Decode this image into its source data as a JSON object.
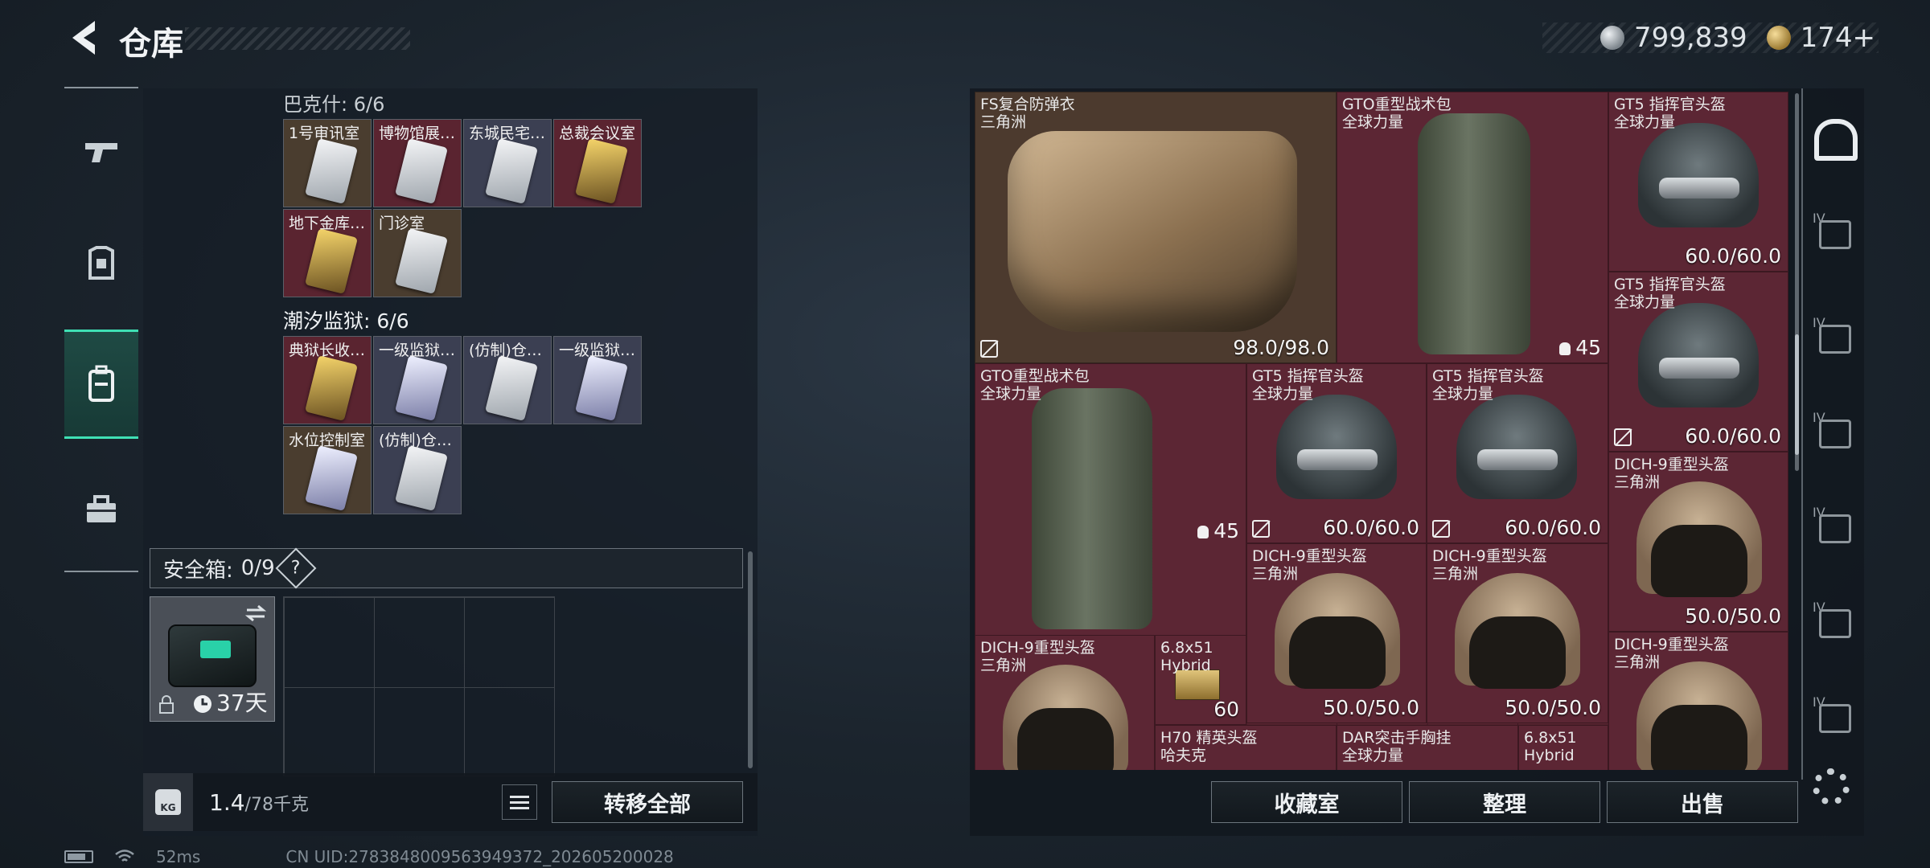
{
  "header": {
    "title": "仓库",
    "currency": [
      {
        "icon": "silver-coin-icon",
        "value": "799,839"
      },
      {
        "icon": "gold-coin-icon",
        "value": "174+"
      }
    ]
  },
  "left_nav": [
    {
      "icon": "weapon-icon"
    },
    {
      "icon": "armor-icon"
    },
    {
      "icon": "backpack-icon",
      "active": true
    },
    {
      "icon": "toolbox-icon"
    }
  ],
  "stash": {
    "group1": {
      "label": "巴克什: 6/6",
      "cards": [
        {
          "label": "1号审讯室",
          "bg": "brown",
          "key": "silver"
        },
        {
          "label": "博物馆展…",
          "bg": "red",
          "key": "silver"
        },
        {
          "label": "东城民宅…",
          "bg": "slate",
          "key": "silver"
        },
        {
          "label": "总裁会议室",
          "bg": "red",
          "key": "gold"
        },
        {
          "label": "地下金库…",
          "bg": "red",
          "key": "gold"
        },
        {
          "label": "门诊室",
          "bg": "brown",
          "key": "silver"
        }
      ]
    },
    "group2": {
      "label": "潮汐监狱: 6/6",
      "cards": [
        {
          "label": "典狱长收…",
          "bg": "red",
          "key": "gold"
        },
        {
          "label": "一级监狱…",
          "bg": "slate",
          "key": "blue"
        },
        {
          "label": "(仿制)仓…",
          "bg": "slate",
          "key": "silver"
        },
        {
          "label": "一级监狱…",
          "bg": "slate",
          "key": "blue"
        },
        {
          "label": "水位控制室",
          "bg": "brown",
          "key": "blue"
        },
        {
          "label": "(仿制)仓…",
          "bg": "slate",
          "key": "silver"
        }
      ]
    },
    "safe_box": {
      "label": "安全箱:",
      "count": "0/9",
      "help": "?"
    },
    "case_item": {
      "days": "37天",
      "swap_icon": "swap-icon",
      "lock_icon": "lock-icon",
      "clock_icon": "clock-icon"
    }
  },
  "weight": {
    "kg_label": "KG",
    "current": "1.4",
    "max": "/78千克"
  },
  "buttons": {
    "transfer_all": "转移全部",
    "collection": "收藏室",
    "organize": "整理",
    "sell": "出售"
  },
  "inventory": [
    {
      "name": "FS复合防弹衣",
      "sub": "三角洲",
      "dur": "98.0/98.0",
      "broken": true,
      "type": "vest",
      "bg": "brown"
    },
    {
      "name": "GTO重型战术包",
      "sub": "全球力量",
      "cap": "45",
      "type": "pack",
      "bg": "red"
    },
    {
      "name": "GT5 指挥官头盔",
      "sub": "全球力量",
      "dur": "60.0/60.0",
      "type": "gt5",
      "bg": "red"
    },
    {
      "name": "GT5 指挥官头盔",
      "sub": "全球力量",
      "dur": "60.0/60.0",
      "broken": true,
      "type": "gt5",
      "bg": "red"
    },
    {
      "name": "GTO重型战术包",
      "sub": "全球力量",
      "cap": "45",
      "type": "pack",
      "bg": "red"
    },
    {
      "name": "GT5 指挥官头盔",
      "sub": "全球力量",
      "dur": "60.0/60.0",
      "broken": true,
      "type": "gt5",
      "bg": "red"
    },
    {
      "name": "GT5 指挥官头盔",
      "sub": "全球力量",
      "dur": "60.0/60.0",
      "broken": true,
      "type": "gt5",
      "bg": "red"
    },
    {
      "name": "DICH-9重型头盔",
      "sub": "三角洲",
      "dur": "50.0/50.0",
      "type": "dich",
      "bg": "red"
    },
    {
      "name": "DICH-9重型头盔",
      "sub": "三角洲",
      "dur": "50.0/50.0",
      "type": "dich",
      "bg": "red"
    },
    {
      "name": "DICH-9重型头盔",
      "sub": "三角洲",
      "dur": "50.0/50.0",
      "type": "dich",
      "bg": "red"
    },
    {
      "name": "DICH-9重型头盔",
      "sub": "三角洲",
      "dur": "",
      "type": "dich",
      "bg": "red"
    },
    {
      "name": "6.8x51",
      "sub": "Hybrid",
      "dur": "60",
      "type": "ammo",
      "bg": "red"
    },
    {
      "name": "DICH-9重型头盔",
      "sub": "三角洲",
      "dur": "",
      "type": "dich",
      "bg": "red"
    },
    {
      "name": "H70 精英头盔",
      "sub": "哈夫克",
      "dur": "",
      "type": "none",
      "bg": "red"
    },
    {
      "name": "DAR突击手胸挂",
      "sub": "全球力量",
      "dur": "",
      "type": "none",
      "bg": "red"
    },
    {
      "name": "6.8x51",
      "sub": "Hybrid",
      "dur": "",
      "type": "none",
      "bg": "red"
    }
  ],
  "right_nav": [
    {
      "icon": "home-base-icon",
      "active": true
    },
    {
      "tier": "IV",
      "icon": "armor-tier-icon"
    },
    {
      "tier": "IV",
      "icon": "medkit-tier-icon"
    },
    {
      "tier": "IV",
      "icon": "case-tier-icon"
    },
    {
      "tier": "IV",
      "icon": "tool-tier-icon"
    },
    {
      "tier": "IV",
      "icon": "gun-tier-icon"
    },
    {
      "tier": "IV",
      "icon": "storage-tier-icon"
    }
  ],
  "status": {
    "ping": "52ms",
    "uid": "CN UID:2783848009563949372_202605200028"
  }
}
